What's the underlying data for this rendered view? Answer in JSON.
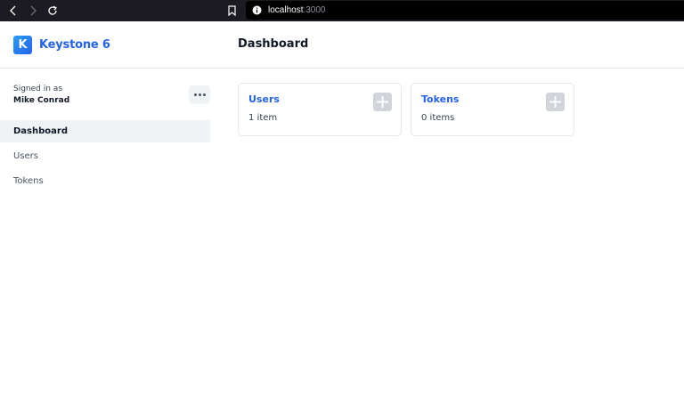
{
  "browser": {
    "url_host": "localhost",
    "url_port": ":3000"
  },
  "app": {
    "brand_letter": "K",
    "brand_name": "Keystone 6",
    "page_title": "Dashboard"
  },
  "sidebar": {
    "signed_in_label": "Signed in as",
    "user_name": "Mike Conrad",
    "items": [
      {
        "label": "Dashboard",
        "active": true
      },
      {
        "label": "Users",
        "active": false
      },
      {
        "label": "Tokens",
        "active": false
      }
    ]
  },
  "cards": [
    {
      "title": "Users",
      "count": "1 item"
    },
    {
      "title": "Tokens",
      "count": "0 items"
    }
  ],
  "colors": {
    "accent": "#2563eb",
    "chrome": "#1c1b22",
    "nav_active_bg": "#eff3f6",
    "add_button_bg": "#d1d5db"
  },
  "icons": {
    "back": "chevron-left-icon",
    "forward": "chevron-right-icon",
    "reload": "reload-icon",
    "bookmark": "bookmark-icon",
    "site_info": "site-info-icon",
    "more": "more-icon",
    "add": "plus-icon"
  }
}
